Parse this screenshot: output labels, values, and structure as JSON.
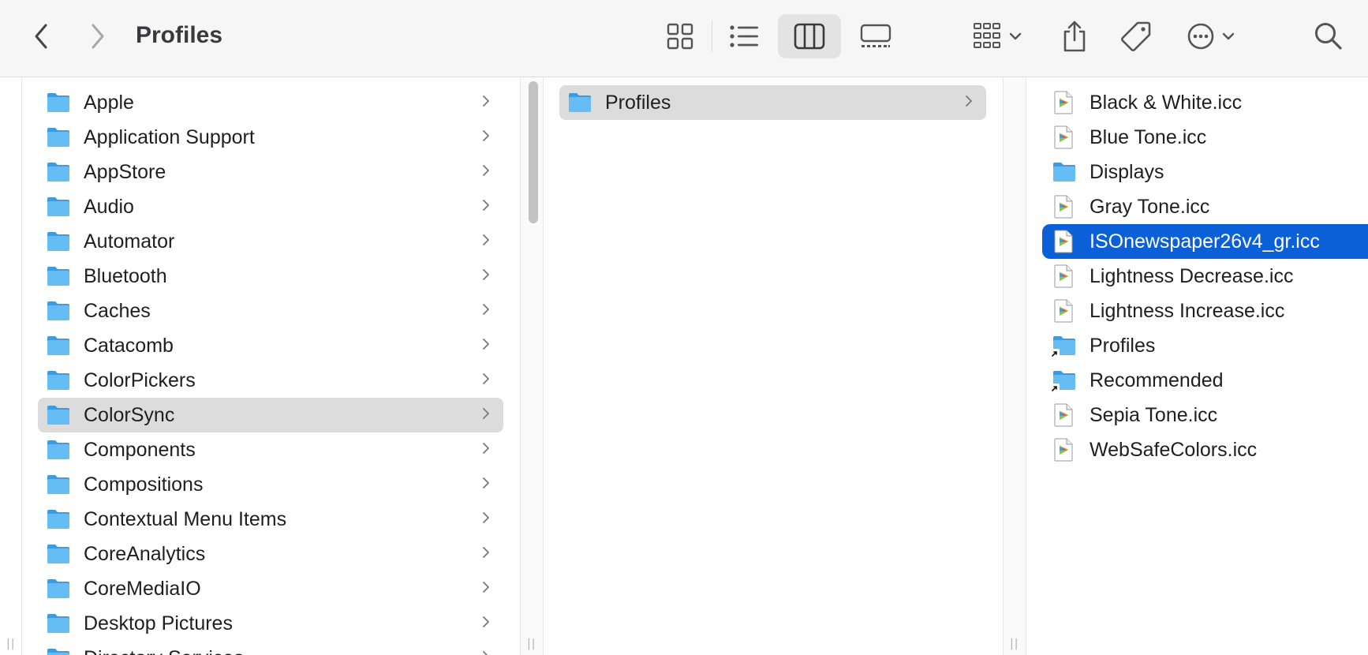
{
  "toolbar": {
    "title": "Profiles",
    "icons": {
      "back": "chevron-left-icon",
      "forward": "chevron-right-icon",
      "icon_view": "grid-icon",
      "list_view": "list-icon",
      "column_view": "columns-icon",
      "gallery_view": "gallery-icon",
      "group": "group-icon",
      "share": "share-icon",
      "tags": "tag-icon",
      "more": "ellipsis-icon",
      "search": "search-icon"
    }
  },
  "column1": {
    "items": [
      {
        "label": "Apple"
      },
      {
        "label": "Application Support"
      },
      {
        "label": "AppStore"
      },
      {
        "label": "Audio"
      },
      {
        "label": "Automator"
      },
      {
        "label": "Bluetooth"
      },
      {
        "label": "Caches"
      },
      {
        "label": "Catacomb"
      },
      {
        "label": "ColorPickers"
      },
      {
        "label": "ColorSync"
      },
      {
        "label": "Components"
      },
      {
        "label": "Compositions"
      },
      {
        "label": "Contextual Menu Items"
      },
      {
        "label": "CoreAnalytics"
      },
      {
        "label": "CoreMediaIO"
      },
      {
        "label": "Desktop Pictures"
      },
      {
        "label": "Directory Services"
      }
    ],
    "selected": "ColorSync"
  },
  "column2": {
    "items": [
      {
        "label": "Profiles"
      }
    ]
  },
  "column3": {
    "items": [
      {
        "label": "Black & White.icc",
        "kind": "icc"
      },
      {
        "label": "Blue Tone.icc",
        "kind": "icc"
      },
      {
        "label": "Displays",
        "kind": "folder"
      },
      {
        "label": "Gray Tone.icc",
        "kind": "icc"
      },
      {
        "label": "ISOnewspaper26v4_gr.icc",
        "kind": "icc"
      },
      {
        "label": "Lightness Decrease.icc",
        "kind": "icc"
      },
      {
        "label": "Lightness Increase.icc",
        "kind": "icc"
      },
      {
        "label": "Profiles",
        "kind": "alias-folder"
      },
      {
        "label": "Recommended",
        "kind": "alias-folder"
      },
      {
        "label": "Sepia Tone.icc",
        "kind": "icc"
      },
      {
        "label": "WebSafeColors.icc",
        "kind": "icc"
      }
    ],
    "selected": "ISOnewspaper26v4_gr.icc"
  },
  "colors": {
    "accent": "#0b60d8",
    "folder": "#5ab5f0",
    "selection_gray": "#dcdcdc"
  }
}
